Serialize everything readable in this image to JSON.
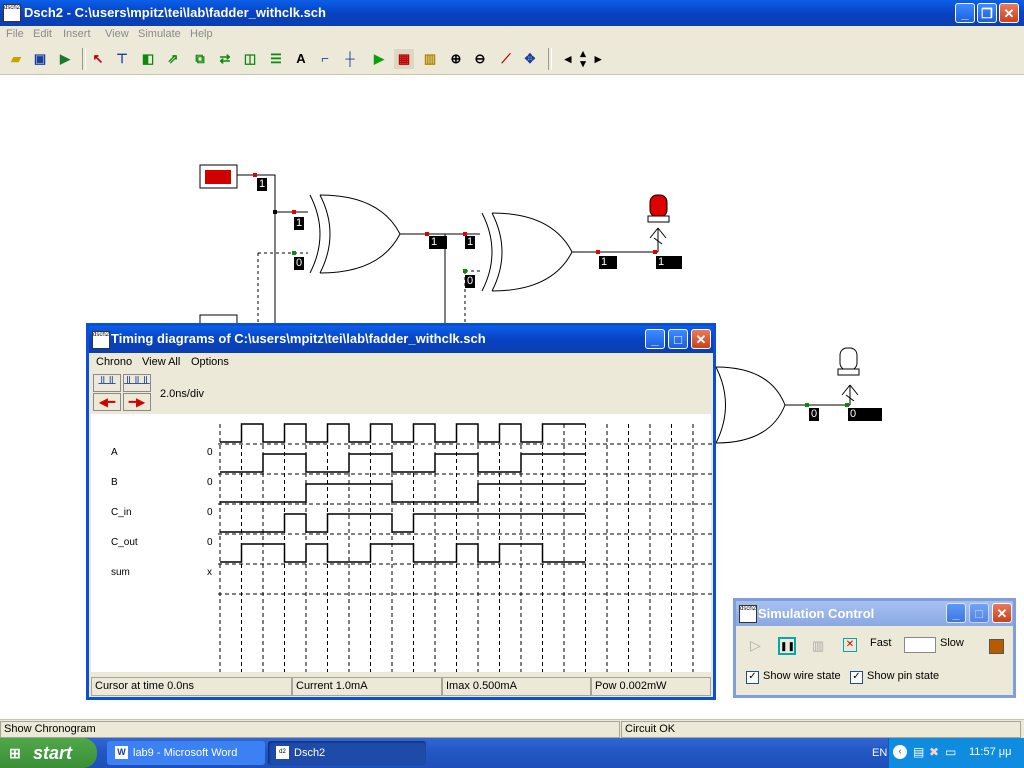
{
  "window": {
    "title": "Dsch2 - C:\\users\\mpitz\\tei\\lab\\fadder_withclk.sch",
    "icon_text": "dsch2"
  },
  "menu": [
    "File",
    "Edit",
    "Insert",
    "View",
    "Simulate",
    "Help"
  ],
  "schematic": {
    "values": [
      "1",
      "1",
      "0",
      "1",
      "1",
      "0",
      "1",
      "1",
      "0",
      "0"
    ]
  },
  "timing": {
    "title": "Timing diagrams of C:\\users\\mpitz\\tei\\lab\\fadder_withclk.sch",
    "menu": [
      "Chrono",
      "View All",
      "Options"
    ],
    "scale": "2.0ns/div",
    "signals": [
      {
        "name": "A",
        "value": "0"
      },
      {
        "name": "B",
        "value": "0"
      },
      {
        "name": "C_in",
        "value": "0"
      },
      {
        "name": "C_out",
        "value": "0"
      },
      {
        "name": "sum",
        "value": "x"
      }
    ],
    "status": {
      "cursor": "Cursor at time  0.0ns",
      "current": "Current  1.0mA",
      "imax": "Imax 0.500mA",
      "pow": "Pow 0.002mW"
    }
  },
  "sim_control": {
    "title": "Simulation Control",
    "fast": "Fast",
    "slow": "Slow",
    "show_wire": "Show wire state",
    "show_pin": "Show pin state"
  },
  "statusbar": {
    "left": "Show Chronogram",
    "right": "Circuit OK"
  },
  "taskbar": {
    "start": "start",
    "tasks": [
      "lab9 - Microsoft Word",
      "Dsch2"
    ],
    "lang": "EN",
    "time": "11:57 μμ"
  }
}
